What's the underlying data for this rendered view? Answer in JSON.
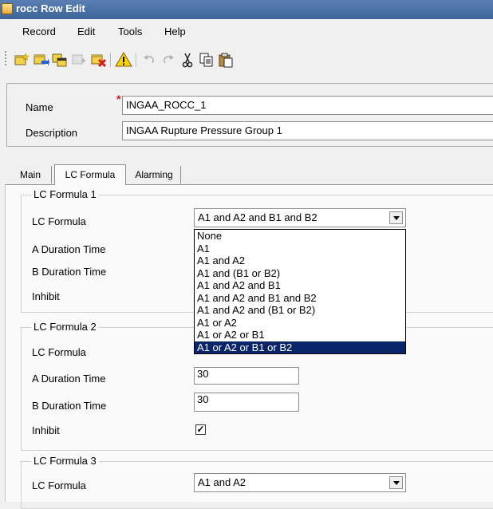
{
  "window": {
    "title": "rocc Row Edit"
  },
  "menu": [
    "Record",
    "Edit",
    "Tools",
    "Help"
  ],
  "header": {
    "name_label": "Name",
    "name_value": "INGAA_ROCC_1",
    "required_mark": "*",
    "description_label": "Description",
    "description_value": "INGAA Rupture Pressure Group 1"
  },
  "tabs": [
    "Main",
    "LC Formula",
    "Alarming"
  ],
  "groups": [
    {
      "title": "LC Formula 1",
      "formula_label": "LC Formula",
      "formula_value": "A1 and A2 and B1 and B2",
      "a_duration_label": "A Duration Time",
      "b_duration_label": "B Duration Time",
      "inhibit_label": "Inhibit"
    },
    {
      "title": "LC Formula 2",
      "formula_label": "LC Formula",
      "a_duration_label": "A Duration Time",
      "a_duration_value": "30",
      "b_duration_label": "B Duration Time",
      "b_duration_value": "30",
      "inhibit_label": "Inhibit",
      "inhibit_checked": "✓"
    },
    {
      "title": "LC Formula 3",
      "formula_label": "LC Formula",
      "formula_value": "A1 and A2"
    }
  ],
  "dropdown": {
    "options": [
      "None",
      "A1",
      "A1 and A2",
      "A1 and (B1 or B2)",
      "A1 and A2 and B1",
      "A1 and A2 and B1 and B2",
      "A1 and A2 and (B1 or B2)",
      "A1 or A2",
      "A1 or A2 or B1",
      "A1 or A2 or B1 or B2"
    ],
    "highlighted": "A1 or A2 or B1 or B2"
  },
  "colors": {
    "titlebar": "#3d6498",
    "highlight": "#0a246a",
    "required": "#e01818"
  }
}
